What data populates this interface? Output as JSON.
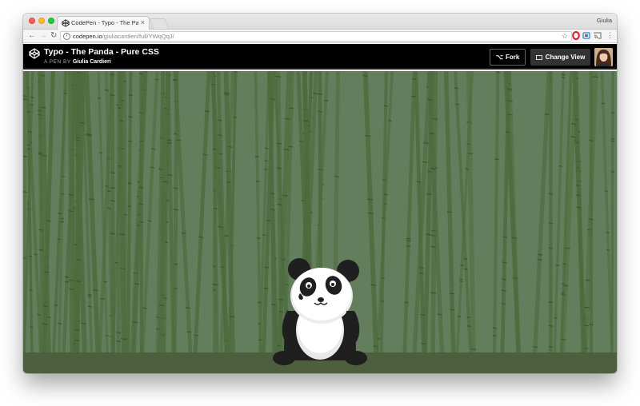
{
  "browser": {
    "tab_title": "CodePen - Typo - The Panda",
    "tab_close": "×",
    "profile_name": "Giulia",
    "url_host": "codepen.io",
    "url_path": "/giuliacardieri/full/YWqQqJ/",
    "info_symbol": "i",
    "star_symbol": "☆",
    "back_symbol": "←",
    "forward_symbol": "→",
    "reload_symbol": "↻",
    "menu_symbol": "⋮",
    "icons": [
      "info-icon",
      "star-icon",
      "opera-icon",
      "vpn-icon",
      "cast-icon",
      "menu-icon"
    ]
  },
  "codepen": {
    "title": "Typo - The Panda - Pure CSS",
    "byline_prefix": "A PEN BY",
    "author": "Giulia Cardieri",
    "fork_label": "Fork",
    "fork_symbol": "⌥",
    "change_view_label": "Change View"
  },
  "scene": {
    "background_color": "#627e5d",
    "bamboo_color": "#4e6b3d",
    "ground_color": "#4d5f3c"
  }
}
